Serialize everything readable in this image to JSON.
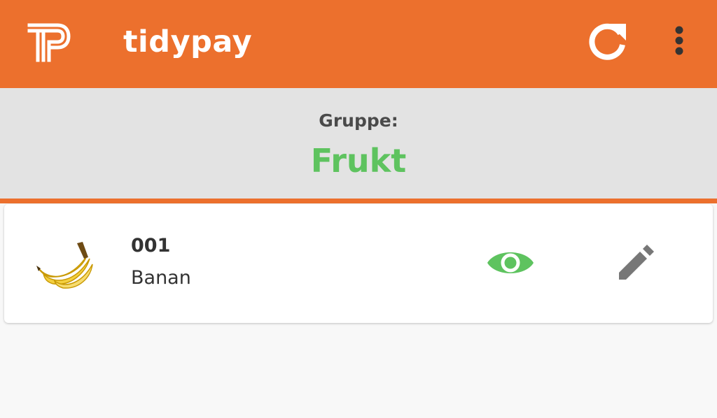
{
  "app_bar": {
    "title": "tidypay",
    "logo_icon": "tidypay-logo-icon",
    "refresh_icon": "refresh-icon",
    "menu_icon": "more-vert-icon",
    "background_color": "#ec702d"
  },
  "group": {
    "label": "Gruppe:",
    "name": "Frukt",
    "name_color": "#5ec35f",
    "background_color": "#e3e3e3"
  },
  "products": [
    {
      "number": "001",
      "name": "Banan",
      "image_icon": "banana-image",
      "visible_icon": "eye-icon",
      "edit_icon": "pencil-icon"
    }
  ]
}
